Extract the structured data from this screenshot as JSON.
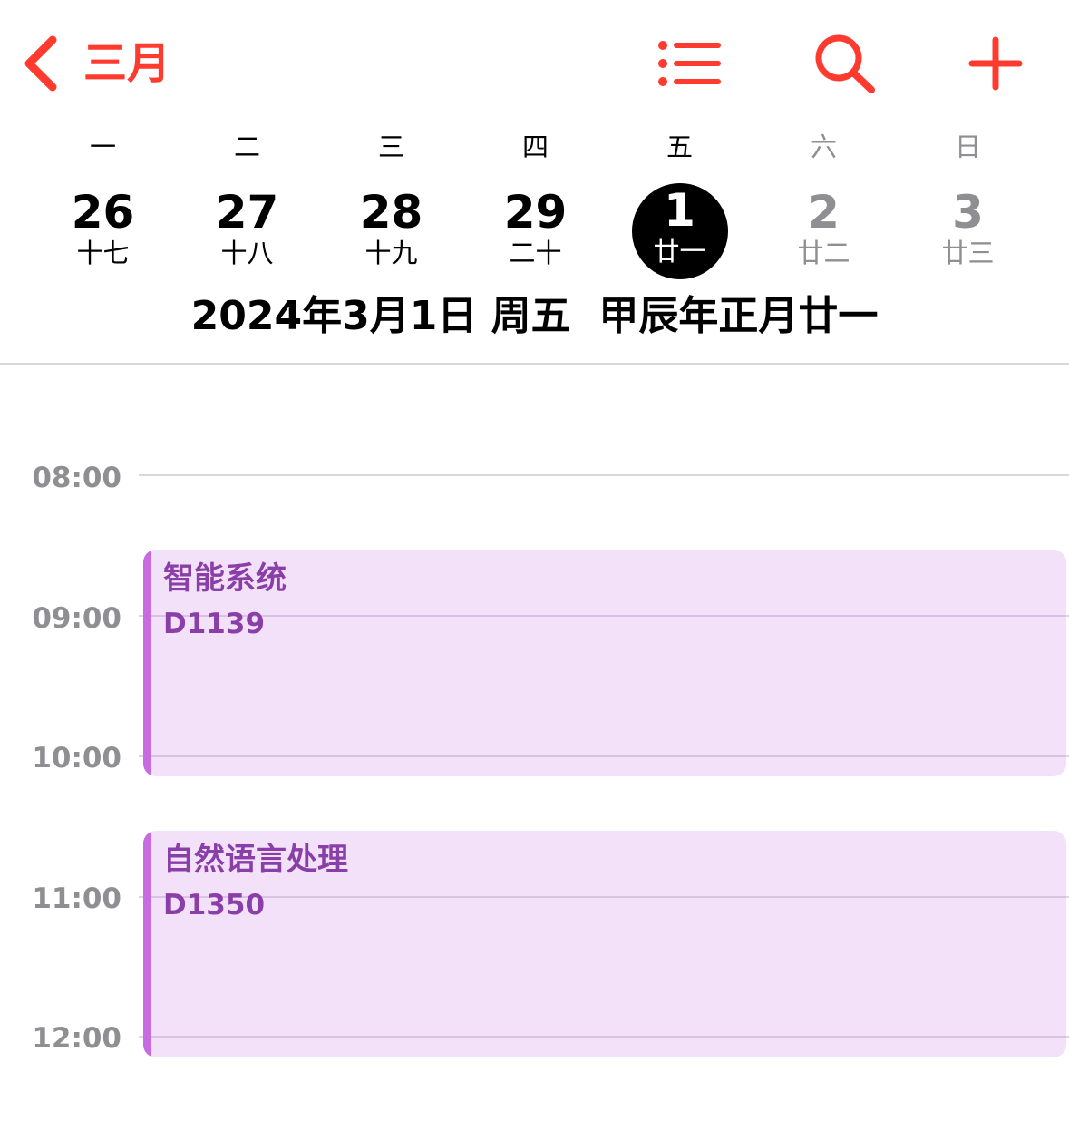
{
  "nav": {
    "back_label": "三月",
    "accent_color": "#FF3B30",
    "icons": [
      "chevron-left-icon",
      "list-icon",
      "search-icon",
      "plus-icon"
    ]
  },
  "week": {
    "days": [
      {
        "weekday": "一",
        "date": "26",
        "lunar": "十七"
      },
      {
        "weekday": "二",
        "date": "27",
        "lunar": "十八"
      },
      {
        "weekday": "三",
        "date": "28",
        "lunar": "十九"
      },
      {
        "weekday": "四",
        "date": "29",
        "lunar": "二十"
      },
      {
        "weekday": "五",
        "date": "1",
        "lunar": "廿一"
      },
      {
        "weekday": "六",
        "date": "2",
        "lunar": "廿二"
      },
      {
        "weekday": "日",
        "date": "3",
        "lunar": "廿三"
      }
    ],
    "selected_day": "1",
    "weekend_color": "#8E8E93"
  },
  "full_date": "2024年3月1日 周五  甲辰年正月廿一",
  "timeline": {
    "hours": [
      "08:00",
      "09:00",
      "10:00",
      "11:00",
      "12:00"
    ]
  },
  "events": [
    {
      "title": "智能系统",
      "location": "D1139",
      "color": "#C86BE3",
      "background": "#F2E1F8"
    },
    {
      "title": "自然语言处理",
      "location": "D1350",
      "color": "#C86BE3",
      "background": "#F2E1F8"
    }
  ]
}
